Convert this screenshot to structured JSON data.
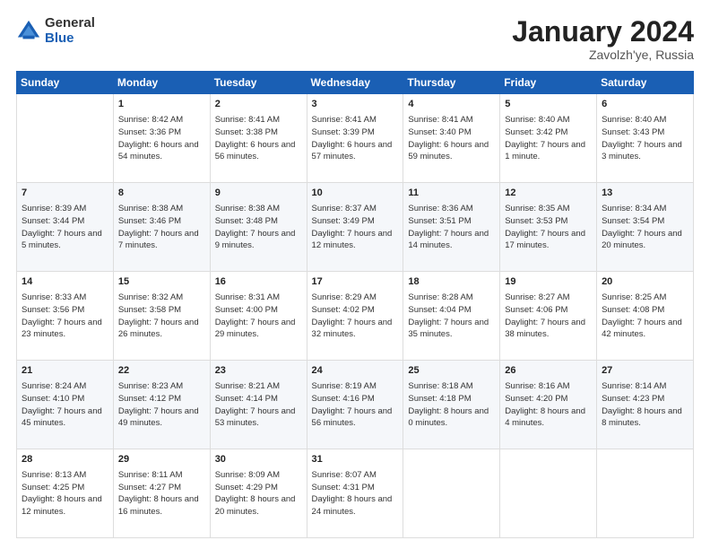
{
  "logo": {
    "general": "General",
    "blue": "Blue"
  },
  "header": {
    "month_year": "January 2024",
    "location": "Zavolzh'ye, Russia"
  },
  "days_of_week": [
    "Sunday",
    "Monday",
    "Tuesday",
    "Wednesday",
    "Thursday",
    "Friday",
    "Saturday"
  ],
  "weeks": [
    [
      {
        "day": "",
        "sunrise": "",
        "sunset": "",
        "daylight": ""
      },
      {
        "day": "1",
        "sunrise": "Sunrise: 8:42 AM",
        "sunset": "Sunset: 3:36 PM",
        "daylight": "Daylight: 6 hours and 54 minutes."
      },
      {
        "day": "2",
        "sunrise": "Sunrise: 8:41 AM",
        "sunset": "Sunset: 3:38 PM",
        "daylight": "Daylight: 6 hours and 56 minutes."
      },
      {
        "day": "3",
        "sunrise": "Sunrise: 8:41 AM",
        "sunset": "Sunset: 3:39 PM",
        "daylight": "Daylight: 6 hours and 57 minutes."
      },
      {
        "day": "4",
        "sunrise": "Sunrise: 8:41 AM",
        "sunset": "Sunset: 3:40 PM",
        "daylight": "Daylight: 6 hours and 59 minutes."
      },
      {
        "day": "5",
        "sunrise": "Sunrise: 8:40 AM",
        "sunset": "Sunset: 3:42 PM",
        "daylight": "Daylight: 7 hours and 1 minute."
      },
      {
        "day": "6",
        "sunrise": "Sunrise: 8:40 AM",
        "sunset": "Sunset: 3:43 PM",
        "daylight": "Daylight: 7 hours and 3 minutes."
      }
    ],
    [
      {
        "day": "7",
        "sunrise": "Sunrise: 8:39 AM",
        "sunset": "Sunset: 3:44 PM",
        "daylight": "Daylight: 7 hours and 5 minutes."
      },
      {
        "day": "8",
        "sunrise": "Sunrise: 8:38 AM",
        "sunset": "Sunset: 3:46 PM",
        "daylight": "Daylight: 7 hours and 7 minutes."
      },
      {
        "day": "9",
        "sunrise": "Sunrise: 8:38 AM",
        "sunset": "Sunset: 3:48 PM",
        "daylight": "Daylight: 7 hours and 9 minutes."
      },
      {
        "day": "10",
        "sunrise": "Sunrise: 8:37 AM",
        "sunset": "Sunset: 3:49 PM",
        "daylight": "Daylight: 7 hours and 12 minutes."
      },
      {
        "day": "11",
        "sunrise": "Sunrise: 8:36 AM",
        "sunset": "Sunset: 3:51 PM",
        "daylight": "Daylight: 7 hours and 14 minutes."
      },
      {
        "day": "12",
        "sunrise": "Sunrise: 8:35 AM",
        "sunset": "Sunset: 3:53 PM",
        "daylight": "Daylight: 7 hours and 17 minutes."
      },
      {
        "day": "13",
        "sunrise": "Sunrise: 8:34 AM",
        "sunset": "Sunset: 3:54 PM",
        "daylight": "Daylight: 7 hours and 20 minutes."
      }
    ],
    [
      {
        "day": "14",
        "sunrise": "Sunrise: 8:33 AM",
        "sunset": "Sunset: 3:56 PM",
        "daylight": "Daylight: 7 hours and 23 minutes."
      },
      {
        "day": "15",
        "sunrise": "Sunrise: 8:32 AM",
        "sunset": "Sunset: 3:58 PM",
        "daylight": "Daylight: 7 hours and 26 minutes."
      },
      {
        "day": "16",
        "sunrise": "Sunrise: 8:31 AM",
        "sunset": "Sunset: 4:00 PM",
        "daylight": "Daylight: 7 hours and 29 minutes."
      },
      {
        "day": "17",
        "sunrise": "Sunrise: 8:29 AM",
        "sunset": "Sunset: 4:02 PM",
        "daylight": "Daylight: 7 hours and 32 minutes."
      },
      {
        "day": "18",
        "sunrise": "Sunrise: 8:28 AM",
        "sunset": "Sunset: 4:04 PM",
        "daylight": "Daylight: 7 hours and 35 minutes."
      },
      {
        "day": "19",
        "sunrise": "Sunrise: 8:27 AM",
        "sunset": "Sunset: 4:06 PM",
        "daylight": "Daylight: 7 hours and 38 minutes."
      },
      {
        "day": "20",
        "sunrise": "Sunrise: 8:25 AM",
        "sunset": "Sunset: 4:08 PM",
        "daylight": "Daylight: 7 hours and 42 minutes."
      }
    ],
    [
      {
        "day": "21",
        "sunrise": "Sunrise: 8:24 AM",
        "sunset": "Sunset: 4:10 PM",
        "daylight": "Daylight: 7 hours and 45 minutes."
      },
      {
        "day": "22",
        "sunrise": "Sunrise: 8:23 AM",
        "sunset": "Sunset: 4:12 PM",
        "daylight": "Daylight: 7 hours and 49 minutes."
      },
      {
        "day": "23",
        "sunrise": "Sunrise: 8:21 AM",
        "sunset": "Sunset: 4:14 PM",
        "daylight": "Daylight: 7 hours and 53 minutes."
      },
      {
        "day": "24",
        "sunrise": "Sunrise: 8:19 AM",
        "sunset": "Sunset: 4:16 PM",
        "daylight": "Daylight: 7 hours and 56 minutes."
      },
      {
        "day": "25",
        "sunrise": "Sunrise: 8:18 AM",
        "sunset": "Sunset: 4:18 PM",
        "daylight": "Daylight: 8 hours and 0 minutes."
      },
      {
        "day": "26",
        "sunrise": "Sunrise: 8:16 AM",
        "sunset": "Sunset: 4:20 PM",
        "daylight": "Daylight: 8 hours and 4 minutes."
      },
      {
        "day": "27",
        "sunrise": "Sunrise: 8:14 AM",
        "sunset": "Sunset: 4:23 PM",
        "daylight": "Daylight: 8 hours and 8 minutes."
      }
    ],
    [
      {
        "day": "28",
        "sunrise": "Sunrise: 8:13 AM",
        "sunset": "Sunset: 4:25 PM",
        "daylight": "Daylight: 8 hours and 12 minutes."
      },
      {
        "day": "29",
        "sunrise": "Sunrise: 8:11 AM",
        "sunset": "Sunset: 4:27 PM",
        "daylight": "Daylight: 8 hours and 16 minutes."
      },
      {
        "day": "30",
        "sunrise": "Sunrise: 8:09 AM",
        "sunset": "Sunset: 4:29 PM",
        "daylight": "Daylight: 8 hours and 20 minutes."
      },
      {
        "day": "31",
        "sunrise": "Sunrise: 8:07 AM",
        "sunset": "Sunset: 4:31 PM",
        "daylight": "Daylight: 8 hours and 24 minutes."
      },
      {
        "day": "",
        "sunrise": "",
        "sunset": "",
        "daylight": ""
      },
      {
        "day": "",
        "sunrise": "",
        "sunset": "",
        "daylight": ""
      },
      {
        "day": "",
        "sunrise": "",
        "sunset": "",
        "daylight": ""
      }
    ]
  ]
}
